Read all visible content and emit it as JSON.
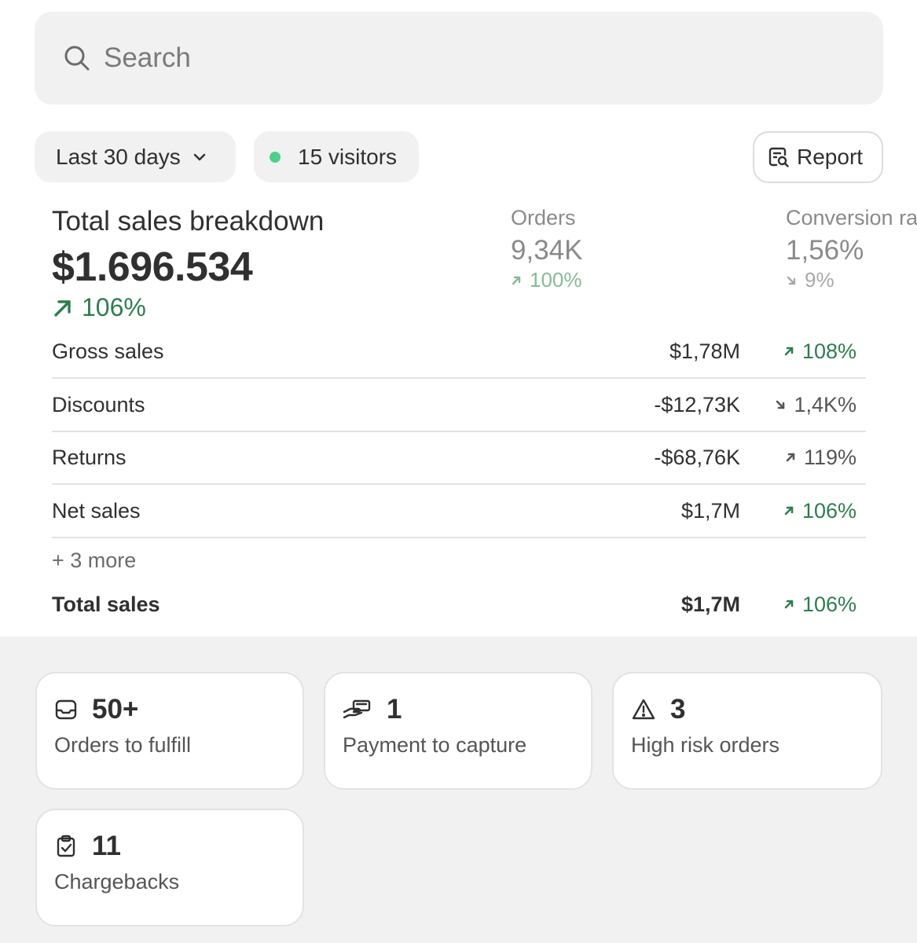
{
  "search": {
    "placeholder": "Search",
    "icon": "search-icon"
  },
  "filters": {
    "date_range": "Last 30 days",
    "visitors": "15 visitors",
    "visitors_dot_color": "#4fd08a",
    "report_label": "Report"
  },
  "summary": {
    "title": "Total sales breakdown",
    "value": "$1.696.534",
    "change": "106%",
    "change_direction": "up"
  },
  "side_metrics": {
    "orders": {
      "label": "Orders",
      "value": "9,34K",
      "change": "100%",
      "direction": "up"
    },
    "conversion": {
      "label": "Conversion ra",
      "value": "1,56%",
      "change": "9%",
      "direction": "down"
    }
  },
  "breakdown": {
    "rows": [
      {
        "name": "Gross sales",
        "amount": "$1,78M",
        "change": "108%",
        "direction": "up"
      },
      {
        "name": "Discounts",
        "amount": "-$12,73K",
        "change": "1,4K%",
        "direction": "down"
      },
      {
        "name": "Returns",
        "amount": "-$68,76K",
        "change": "119%",
        "direction": "up"
      },
      {
        "name": "Net sales",
        "amount": "$1,7M",
        "change": "106%",
        "direction": "up"
      }
    ],
    "more": "+ 3 more",
    "total": {
      "name": "Total sales",
      "amount": "$1,7M",
      "change": "106%",
      "direction": "up"
    }
  },
  "tasks": [
    {
      "count": "50+",
      "label": "Orders to fulfill",
      "icon": "inbox-icon"
    },
    {
      "count": "1",
      "label": "Payment to capture",
      "icon": "hand-money-icon"
    },
    {
      "count": "3",
      "label": "High risk orders",
      "icon": "alert-triangle-icon"
    },
    {
      "count": "11",
      "label": "Chargebacks",
      "icon": "clipboard-check-icon"
    }
  ],
  "colors": {
    "positive": "#2e7d4f",
    "muted_positive": "#86b99b",
    "page_bg": "#f1f1f1"
  }
}
